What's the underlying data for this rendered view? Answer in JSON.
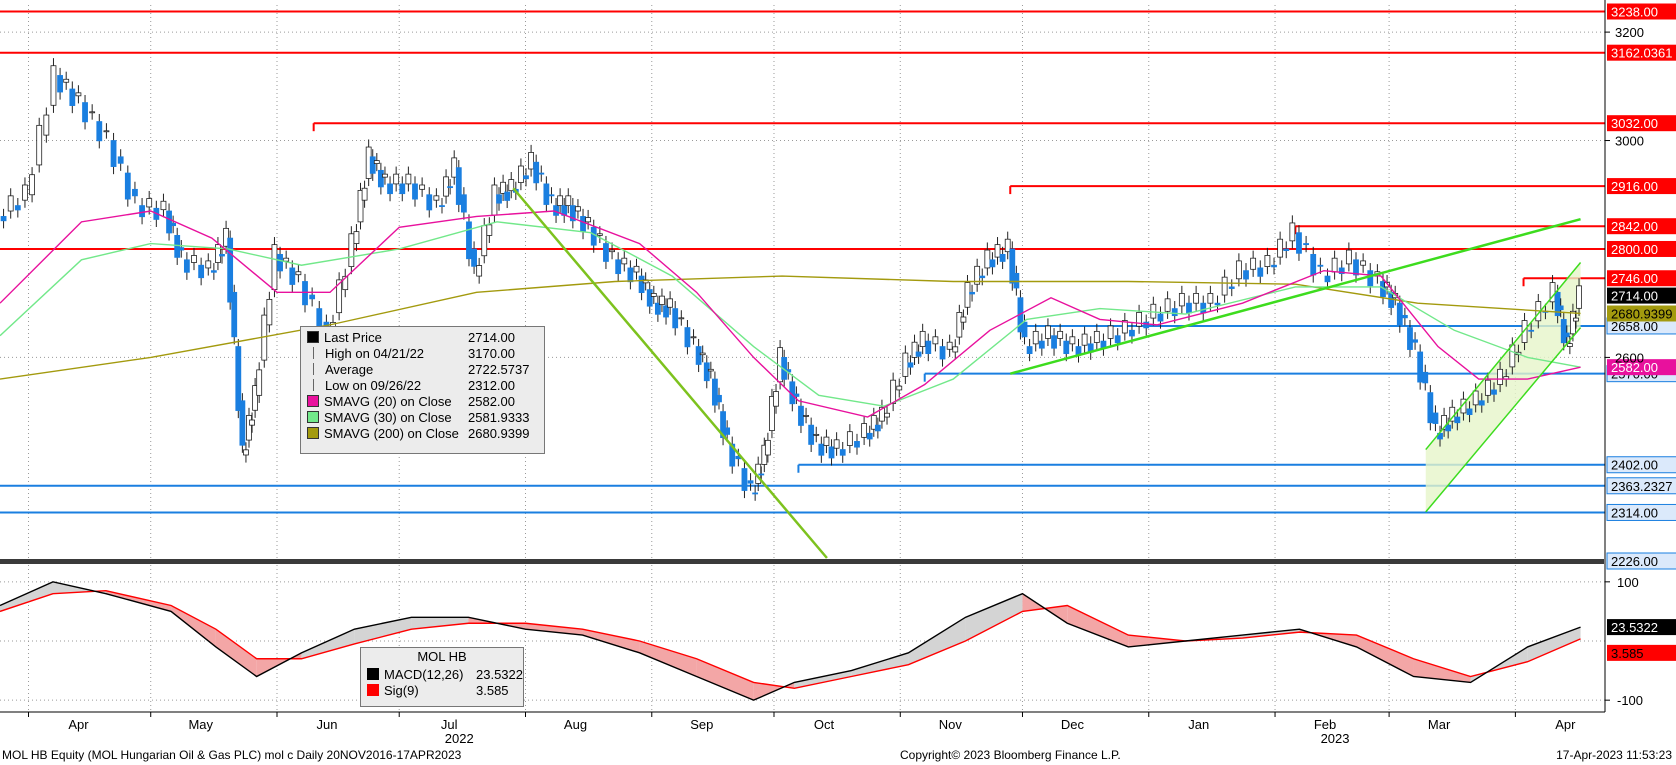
{
  "colors": {
    "candle_up": "#1a7fe0",
    "resistance": "#ff0000",
    "support": "#1a7fe0",
    "trend": "#3ddc1e",
    "sma20": "#e8119d",
    "sma30": "#72e88a",
    "sma200": "#a39a0e",
    "macd": "#000000",
    "signal": "#ff0000"
  },
  "chart_data": [
    {
      "type": "candlestick",
      "title": "MOL HB Equity (MOL Hungarian Oil & Gas PLC) mol c Daily 20NOV2016-17APR2023",
      "ylim": [
        2230,
        3250
      ],
      "y_ticks": [
        2600,
        3000,
        3200
      ],
      "x_ticks": [
        {
          "label": "Apr",
          "date": "2022-04-01"
        },
        {
          "label": "May",
          "date": "2022-05-01"
        },
        {
          "label": "Jun",
          "date": "2022-06-01"
        },
        {
          "label": "Jul",
          "date": "2022-07-01"
        },
        {
          "label": "Aug",
          "date": "2022-08-01"
        },
        {
          "label": "Sep",
          "date": "2022-09-01"
        },
        {
          "label": "Oct",
          "date": "2022-10-01"
        },
        {
          "label": "Nov",
          "date": "2022-11-01"
        },
        {
          "label": "Dec",
          "date": "2022-12-01"
        },
        {
          "label": "Jan",
          "date": "2023-01-01"
        },
        {
          "label": "Feb",
          "date": "2023-02-01"
        },
        {
          "label": "Mar",
          "date": "2023-03-01"
        },
        {
          "label": "Apr",
          "date": "2023-04-01"
        }
      ],
      "year_labels": [
        {
          "label": "2022",
          "date": "2022-07-01"
        },
        {
          "label": "2023",
          "date": "2023-02-01"
        }
      ],
      "close_series": [
        [
          "2022-03-25",
          2860
        ],
        [
          "2022-04-01",
          2900
        ],
        [
          "2022-04-08",
          3120
        ],
        [
          "2022-04-14",
          3070
        ],
        [
          "2022-04-21",
          3000
        ],
        [
          "2022-04-28",
          2880
        ],
        [
          "2022-05-05",
          2870
        ],
        [
          "2022-05-09",
          2780
        ],
        [
          "2022-05-16",
          2760
        ],
        [
          "2022-05-20",
          2820
        ],
        [
          "2022-05-24",
          2420
        ],
        [
          "2022-05-27",
          2530
        ],
        [
          "2022-06-01",
          2790
        ],
        [
          "2022-06-07",
          2740
        ],
        [
          "2022-06-14",
          2640
        ],
        [
          "2022-06-20",
          2810
        ],
        [
          "2022-06-24",
          2970
        ],
        [
          "2022-06-28",
          2920
        ],
        [
          "2022-07-04",
          2920
        ],
        [
          "2022-07-11",
          2880
        ],
        [
          "2022-07-15",
          2950
        ],
        [
          "2022-07-20",
          2750
        ],
        [
          "2022-07-25",
          2900
        ],
        [
          "2022-07-29",
          2910
        ],
        [
          "2022-08-03",
          2960
        ],
        [
          "2022-08-08",
          2880
        ],
        [
          "2022-08-12",
          2880
        ],
        [
          "2022-08-17",
          2840
        ],
        [
          "2022-08-23",
          2780
        ],
        [
          "2022-08-29",
          2750
        ],
        [
          "2022-09-02",
          2700
        ],
        [
          "2022-09-06",
          2690
        ],
        [
          "2022-09-12",
          2620
        ],
        [
          "2022-09-16",
          2560
        ],
        [
          "2022-09-20",
          2440
        ],
        [
          "2022-09-26",
          2350
        ],
        [
          "2022-09-29",
          2420
        ],
        [
          "2022-10-03",
          2600
        ],
        [
          "2022-10-07",
          2510
        ],
        [
          "2022-10-12",
          2440
        ],
        [
          "2022-10-17",
          2430
        ],
        [
          "2022-10-24",
          2460
        ],
        [
          "2022-10-28",
          2490
        ],
        [
          "2022-11-03",
          2590
        ],
        [
          "2022-11-07",
          2630
        ],
        [
          "2022-11-14",
          2610
        ],
        [
          "2022-11-18",
          2720
        ],
        [
          "2022-11-23",
          2780
        ],
        [
          "2022-11-28",
          2800
        ],
        [
          "2022-12-02",
          2620
        ],
        [
          "2022-12-08",
          2640
        ],
        [
          "2022-12-14",
          2620
        ],
        [
          "2022-12-20",
          2630
        ],
        [
          "2022-12-27",
          2650
        ],
        [
          "2023-01-03",
          2680
        ],
        [
          "2023-01-10",
          2700
        ],
        [
          "2023-01-17",
          2700
        ],
        [
          "2023-01-24",
          2760
        ],
        [
          "2023-01-31",
          2770
        ],
        [
          "2023-02-06",
          2830
        ],
        [
          "2023-02-13",
          2750
        ],
        [
          "2023-02-20",
          2780
        ],
        [
          "2023-02-27",
          2740
        ],
        [
          "2023-03-03",
          2700
        ],
        [
          "2023-03-08",
          2610
        ],
        [
          "2023-03-13",
          2460
        ],
        [
          "2023-03-17",
          2490
        ],
        [
          "2023-03-23",
          2520
        ],
        [
          "2023-03-29",
          2560
        ],
        [
          "2023-04-04",
          2650
        ],
        [
          "2023-04-11",
          2720
        ],
        [
          "2023-04-14",
          2620
        ],
        [
          "2023-04-17",
          2714
        ]
      ],
      "sma20": [
        [
          "2022-03-25",
          2700
        ],
        [
          "2022-04-14",
          2850
        ],
        [
          "2022-05-01",
          2870
        ],
        [
          "2022-05-16",
          2820
        ],
        [
          "2022-06-01",
          2720
        ],
        [
          "2022-06-14",
          2720
        ],
        [
          "2022-07-01",
          2840
        ],
        [
          "2022-07-20",
          2860
        ],
        [
          "2022-08-08",
          2870
        ],
        [
          "2022-08-29",
          2810
        ],
        [
          "2022-09-12",
          2720
        ],
        [
          "2022-09-26",
          2600
        ],
        [
          "2022-10-07",
          2520
        ],
        [
          "2022-10-24",
          2490
        ],
        [
          "2022-11-07",
          2550
        ],
        [
          "2022-11-23",
          2650
        ],
        [
          "2022-12-08",
          2710
        ],
        [
          "2022-12-20",
          2670
        ],
        [
          "2023-01-03",
          2660
        ],
        [
          "2023-01-24",
          2700
        ],
        [
          "2023-02-13",
          2760
        ],
        [
          "2023-02-27",
          2750
        ],
        [
          "2023-03-13",
          2620
        ],
        [
          "2023-03-23",
          2560
        ],
        [
          "2023-04-04",
          2560
        ],
        [
          "2023-04-17",
          2582
        ]
      ],
      "sma30": [
        [
          "2022-03-25",
          2640
        ],
        [
          "2022-04-14",
          2780
        ],
        [
          "2022-05-01",
          2810
        ],
        [
          "2022-05-20",
          2800
        ],
        [
          "2022-06-07",
          2770
        ],
        [
          "2022-07-01",
          2800
        ],
        [
          "2022-07-25",
          2850
        ],
        [
          "2022-08-17",
          2830
        ],
        [
          "2022-09-06",
          2750
        ],
        [
          "2022-09-26",
          2620
        ],
        [
          "2022-10-12",
          2530
        ],
        [
          "2022-10-28",
          2510
        ],
        [
          "2022-11-14",
          2560
        ],
        [
          "2022-12-02",
          2670
        ],
        [
          "2022-12-20",
          2690
        ],
        [
          "2023-01-10",
          2680
        ],
        [
          "2023-02-06",
          2730
        ],
        [
          "2023-02-27",
          2730
        ],
        [
          "2023-03-17",
          2650
        ],
        [
          "2023-04-04",
          2600
        ],
        [
          "2023-04-17",
          2582
        ]
      ],
      "sma200": [
        [
          "2022-03-25",
          2560
        ],
        [
          "2022-05-01",
          2600
        ],
        [
          "2022-06-14",
          2660
        ],
        [
          "2022-07-20",
          2720
        ],
        [
          "2022-08-23",
          2740
        ],
        [
          "2022-10-03",
          2750
        ],
        [
          "2022-11-14",
          2740
        ],
        [
          "2022-12-27",
          2740
        ],
        [
          "2023-02-06",
          2735
        ],
        [
          "2023-03-08",
          2700
        ],
        [
          "2023-04-17",
          2681
        ]
      ],
      "resistance_levels": [
        {
          "value": 3238.0,
          "label": "3238.00",
          "start": "2022-03-25"
        },
        {
          "value": 3162.0361,
          "label": "3162.0361",
          "start": "2022-03-25"
        },
        {
          "value": 3032.0,
          "label": "3032.00",
          "start": "2022-06-10"
        },
        {
          "value": 2916.0,
          "label": "2916.00",
          "start": "2022-11-28"
        },
        {
          "value": 2842.0,
          "label": "2842.00",
          "start": "2023-02-06"
        },
        {
          "value": 2800.0,
          "label": "2800.00",
          "start": "2022-03-25"
        },
        {
          "value": 2746.0,
          "label": "2746.00",
          "start": "2023-04-03"
        }
      ],
      "support_levels": [
        {
          "value": 2658.0,
          "label": "2658.00",
          "start": "2022-12-01"
        },
        {
          "value": 2570.0,
          "label": "2570.00",
          "start": "2022-11-07"
        },
        {
          "value": 2402.0,
          "label": "2402.00",
          "start": "2022-10-07"
        },
        {
          "value": 2363.2327,
          "label": "2363.2327",
          "start": "2022-03-25"
        },
        {
          "value": 2314.0,
          "label": "2314.00",
          "start": "2022-03-25"
        }
      ],
      "last_value_tags": [
        {
          "label": "2714.00",
          "value": 2714,
          "bg": "#000000",
          "fg": "#ffffff"
        },
        {
          "label": "2680.9399",
          "value": 2681,
          "bg": "#a39a0e",
          "fg": "#000000"
        },
        {
          "label": "2582.00",
          "value": 2582,
          "bg": "#e8119d",
          "fg": "#ffffff"
        }
      ],
      "clipped_tags": [
        {
          "label": "2226.00",
          "value": 2226
        }
      ],
      "trendlines": [
        {
          "from": [
            "2022-07-29",
            2912
          ],
          "to": [
            "2022-10-14",
            2230
          ]
        },
        {
          "from": [
            "2022-11-28",
            2570
          ],
          "to": [
            "2023-04-17",
            2855
          ]
        },
        {
          "from": [
            "2023-03-10",
            2430
          ],
          "to": [
            "2023-04-17",
            2775
          ]
        },
        {
          "from": [
            "2023-03-10",
            2315
          ],
          "to": [
            "2023-04-17",
            2655
          ]
        }
      ],
      "legend": {
        "rows": [
          {
            "label": "Last Price",
            "value": "2714.00",
            "sym": "square",
            "color": "#000000"
          },
          {
            "label": "High on 04/21/22",
            "value": "3170.00",
            "sym": "high"
          },
          {
            "label": "Average",
            "value": "2722.5737",
            "sym": "avg"
          },
          {
            "label": "Low on 09/26/22",
            "value": "2312.00",
            "sym": "low"
          },
          {
            "label": "SMAVG (20)  on Close",
            "value": "2582.00",
            "sym": "square",
            "color": "#e8119d"
          },
          {
            "label": "SMAVG (30)  on Close",
            "value": "2581.9333",
            "sym": "square",
            "color": "#72e88a"
          },
          {
            "label": "SMAVG (200)  on Close",
            "value": "2680.9399",
            "sym": "square",
            "color": "#a39a0e"
          }
        ]
      }
    },
    {
      "type": "line",
      "title": "MOL HB",
      "ylim": [
        -120,
        120
      ],
      "y_ticks": [
        100,
        -100
      ],
      "series": [
        {
          "name": "MACD(12,26)",
          "value": "23.5322",
          "color": "#000000",
          "points": [
            [
              "2022-03-25",
              60
            ],
            [
              "2022-04-07",
              100
            ],
            [
              "2022-04-20",
              80
            ],
            [
              "2022-05-06",
              50
            ],
            [
              "2022-05-17",
              -10
            ],
            [
              "2022-05-27",
              -60
            ],
            [
              "2022-06-07",
              -20
            ],
            [
              "2022-06-20",
              20
            ],
            [
              "2022-07-04",
              40
            ],
            [
              "2022-07-18",
              40
            ],
            [
              "2022-08-01",
              20
            ],
            [
              "2022-08-15",
              10
            ],
            [
              "2022-08-29",
              -20
            ],
            [
              "2022-09-12",
              -60
            ],
            [
              "2022-09-26",
              -100
            ],
            [
              "2022-10-06",
              -70
            ],
            [
              "2022-10-20",
              -50
            ],
            [
              "2022-11-03",
              -20
            ],
            [
              "2022-11-17",
              40
            ],
            [
              "2022-12-01",
              80
            ],
            [
              "2022-12-12",
              30
            ],
            [
              "2022-12-27",
              -10
            ],
            [
              "2023-01-10",
              0
            ],
            [
              "2023-01-24",
              10
            ],
            [
              "2023-02-07",
              20
            ],
            [
              "2023-02-21",
              -10
            ],
            [
              "2023-03-07",
              -60
            ],
            [
              "2023-03-21",
              -70
            ],
            [
              "2023-04-04",
              -10
            ],
            [
              "2023-04-17",
              23.5
            ]
          ]
        },
        {
          "name": "Sig(9)",
          "value": "3.585",
          "color": "#ff0000",
          "points": [
            [
              "2022-03-25",
              50
            ],
            [
              "2022-04-07",
              80
            ],
            [
              "2022-04-20",
              85
            ],
            [
              "2022-05-06",
              60
            ],
            [
              "2022-05-17",
              20
            ],
            [
              "2022-05-27",
              -30
            ],
            [
              "2022-06-07",
              -30
            ],
            [
              "2022-06-20",
              -5
            ],
            [
              "2022-07-04",
              20
            ],
            [
              "2022-07-18",
              30
            ],
            [
              "2022-08-01",
              30
            ],
            [
              "2022-08-15",
              20
            ],
            [
              "2022-08-29",
              0
            ],
            [
              "2022-09-12",
              -30
            ],
            [
              "2022-09-26",
              -70
            ],
            [
              "2022-10-06",
              -80
            ],
            [
              "2022-10-20",
              -60
            ],
            [
              "2022-11-03",
              -40
            ],
            [
              "2022-11-17",
              0
            ],
            [
              "2022-12-01",
              50
            ],
            [
              "2022-12-12",
              60
            ],
            [
              "2022-12-27",
              10
            ],
            [
              "2023-01-10",
              0
            ],
            [
              "2023-01-24",
              5
            ],
            [
              "2023-02-07",
              15
            ],
            [
              "2023-02-21",
              10
            ],
            [
              "2023-03-07",
              -30
            ],
            [
              "2023-03-21",
              -60
            ],
            [
              "2023-04-04",
              -35
            ],
            [
              "2023-04-17",
              3.6
            ]
          ]
        }
      ]
    }
  ],
  "footer": {
    "left": "MOL HB Equity (MOL Hungarian Oil & Gas PLC) mol c  Daily 20NOV2016-17APR2023",
    "center": "Copyright© 2023 Bloomberg Finance L.P.",
    "right": "17-Apr-2023 11:53:23"
  }
}
